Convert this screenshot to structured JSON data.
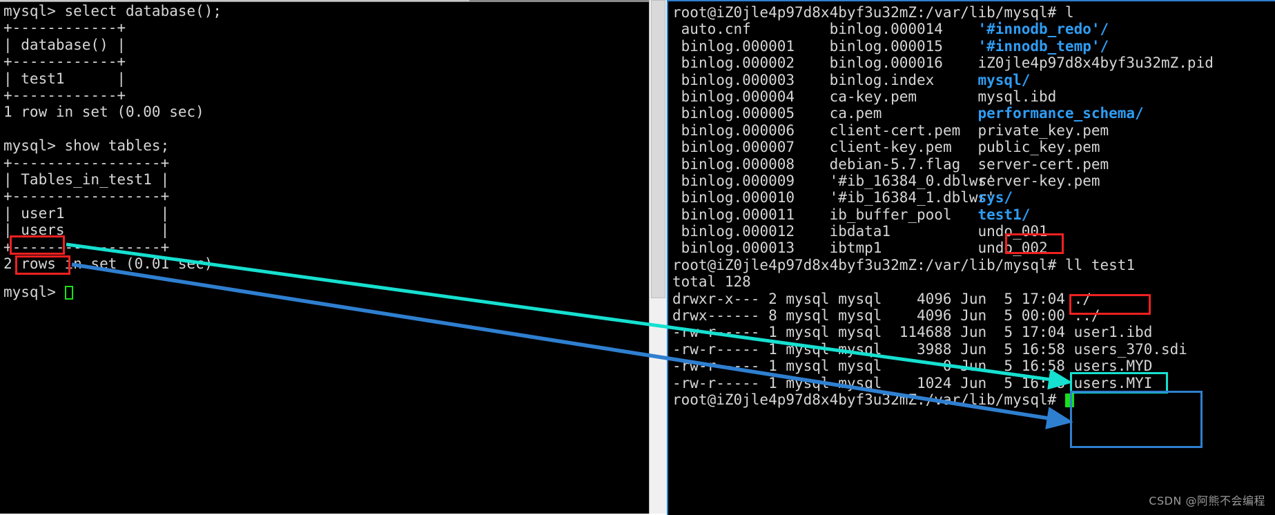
{
  "left_terminal": {
    "name": "mysql-client-terminal",
    "lines": [
      "mysql> select database();",
      "+------------+",
      "| database() |",
      "+------------+",
      "| test1      |",
      "+------------+",
      "1 row in set (0.00 sec)",
      "",
      "mysql> show tables;",
      "+-----------------+",
      "| Tables_in_test1 |",
      "+-----------------+",
      "| user1           |",
      "| users           |",
      "+-----------------+",
      "2 rows in set (0.01 sec)",
      "",
      "mysql> "
    ],
    "prompt": "mysql> ",
    "cursor": "block"
  },
  "right_terminal": {
    "name": "shell-terminal",
    "prompt_1": "root@iZ0jle4p97d8x4byf3u32mZ:/var/lib/mysql# l",
    "listing_columns": [
      [
        {
          "text": "auto.cnf",
          "type": "file"
        },
        {
          "text": "binlog.000001",
          "type": "file"
        },
        {
          "text": "binlog.000002",
          "type": "file"
        },
        {
          "text": "binlog.000003",
          "type": "file"
        },
        {
          "text": "binlog.000004",
          "type": "file"
        },
        {
          "text": "binlog.000005",
          "type": "file"
        },
        {
          "text": "binlog.000006",
          "type": "file"
        },
        {
          "text": "binlog.000007",
          "type": "file"
        },
        {
          "text": "binlog.000008",
          "type": "file"
        },
        {
          "text": "binlog.000009",
          "type": "file"
        },
        {
          "text": "binlog.000010",
          "type": "file"
        },
        {
          "text": "binlog.000011",
          "type": "file"
        },
        {
          "text": "binlog.000012",
          "type": "file"
        },
        {
          "text": "binlog.000013",
          "type": "file"
        }
      ],
      [
        {
          "text": "binlog.000014",
          "type": "file"
        },
        {
          "text": "binlog.000015",
          "type": "file"
        },
        {
          "text": "binlog.000016",
          "type": "file"
        },
        {
          "text": "binlog.index",
          "type": "file"
        },
        {
          "text": "ca-key.pem",
          "type": "file"
        },
        {
          "text": "ca.pem",
          "type": "file"
        },
        {
          "text": "client-cert.pem",
          "type": "file"
        },
        {
          "text": "client-key.pem",
          "type": "file"
        },
        {
          "text": "debian-5.7.flag",
          "type": "file"
        },
        {
          "text": "'#ib_16384_0.dblwr'",
          "type": "file"
        },
        {
          "text": "'#ib_16384_1.dblwr'",
          "type": "file"
        },
        {
          "text": "ib_buffer_pool",
          "type": "file"
        },
        {
          "text": "ibdata1",
          "type": "file"
        },
        {
          "text": "ibtmp1",
          "type": "file"
        }
      ],
      [
        {
          "text": "'#innodb_redo'/",
          "type": "dir"
        },
        {
          "text": "'#innodb_temp'/",
          "type": "dir"
        },
        {
          "text": "iZ0jle4p97d8x4byf3u32mZ.pid",
          "type": "file"
        },
        {
          "text": "mysql/",
          "type": "dir"
        },
        {
          "text": "mysql.ibd",
          "type": "file"
        },
        {
          "text": "performance_schema/",
          "type": "dir"
        },
        {
          "text": "private_key.pem",
          "type": "file"
        },
        {
          "text": "public_key.pem",
          "type": "file"
        },
        {
          "text": "server-cert.pem",
          "type": "file"
        },
        {
          "text": "server-key.pem",
          "type": "file"
        },
        {
          "text": "sys/",
          "type": "dir"
        },
        {
          "text": "test1/",
          "type": "dir"
        },
        {
          "text": "undo_001",
          "type": "file"
        },
        {
          "text": "undo_002",
          "type": "file"
        }
      ]
    ],
    "prompt_2_prefix": "root@iZ0jle4p97d8x4byf3u32mZ:/var/lib/mysql# ",
    "command_2": "ll test1",
    "total_line": "total 128",
    "ll_rows": [
      {
        "perms": "drwxr-x---",
        "links": "2",
        "owner": "mysql",
        "group": "mysql",
        "size": "4096",
        "month": "Jun",
        "day": "5",
        "time": "17:04",
        "name": "./"
      },
      {
        "perms": "drwx------",
        "links": "8",
        "owner": "mysql",
        "group": "mysql",
        "size": "4096",
        "month": "Jun",
        "day": "5",
        "time": "00:00",
        "name": "../"
      },
      {
        "perms": "-rw-r-----",
        "links": "1",
        "owner": "mysql",
        "group": "mysql",
        "size": "114688",
        "month": "Jun",
        "day": "5",
        "time": "17:04",
        "name": "user1.ibd"
      },
      {
        "perms": "-rw-r-----",
        "links": "1",
        "owner": "mysql",
        "group": "mysql",
        "size": "3988",
        "month": "Jun",
        "day": "5",
        "time": "16:58",
        "name": "users_370.sdi"
      },
      {
        "perms": "-rw-r-----",
        "links": "1",
        "owner": "mysql",
        "group": "mysql",
        "size": "0",
        "month": "Jun",
        "day": "5",
        "time": "16:58",
        "name": "users.MYD"
      },
      {
        "perms": "-rw-r-----",
        "links": "1",
        "owner": "mysql",
        "group": "mysql",
        "size": "1024",
        "month": "Jun",
        "day": "5",
        "time": "16:58",
        "name": "users.MYI"
      }
    ],
    "prompt_3": "root@iZ0jle4p97d8x4byf3u32mZ:/var/lib/mysql# ",
    "cursor": "solid-block"
  },
  "annotations": {
    "highlight_user1_label": "user1",
    "highlight_users_label": "users",
    "highlight_test1_label": "test1/",
    "highlight_ll_test1_label": "ll test1",
    "highlight_user1_ibd_label": "user1.ibd",
    "highlight_users_files_label": "users_370.sdi / users.MYD / users.MYI",
    "colors": {
      "red": "#f02020",
      "teal": "#16e0d0",
      "blue": "#2f7fd0",
      "dir_blue": "#2f9df4",
      "terminal_fg": "#d6d6d6",
      "terminal_bg": "#000000",
      "cursor_green": "#19e019"
    },
    "arrows": [
      {
        "name": "user1-to-user1-ibd",
        "color": "#16e0d0",
        "from": "user1",
        "to": "user1.ibd"
      },
      {
        "name": "users-to-users-files",
        "color": "#2f7fd0",
        "from": "users",
        "to": "users_370.sdi"
      }
    ]
  },
  "watermark": {
    "text": "CSDN @阿熊不会编程"
  }
}
